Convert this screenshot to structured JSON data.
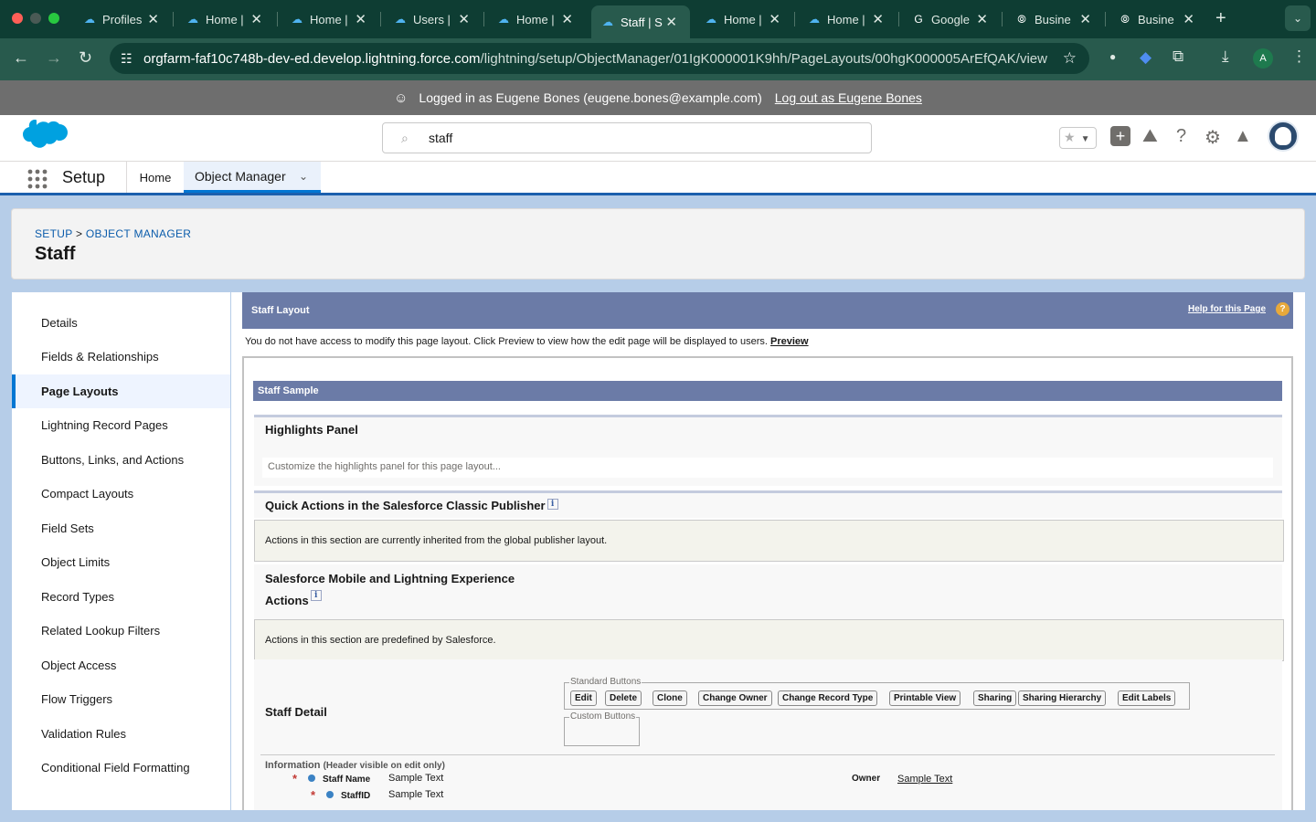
{
  "browser": {
    "tabs": [
      {
        "title": "Profiles",
        "icon": "salesforce-cloud-icon"
      },
      {
        "title": "Home |",
        "icon": "salesforce-cloud-icon"
      },
      {
        "title": "Home |",
        "icon": "salesforce-cloud-icon"
      },
      {
        "title": "Users |",
        "icon": "salesforce-cloud-icon"
      },
      {
        "title": "Home |",
        "icon": "salesforce-cloud-icon"
      },
      {
        "title": "Staff | S",
        "icon": "salesforce-cloud-icon",
        "active": true
      },
      {
        "title": "Home |",
        "icon": "salesforce-cloud-icon"
      },
      {
        "title": "Home |",
        "icon": "salesforce-cloud-icon"
      },
      {
        "title": "Google",
        "icon": "google-icon"
      },
      {
        "title": "Busine",
        "icon": "openai-icon"
      },
      {
        "title": "Busine",
        "icon": "openai-icon"
      }
    ],
    "url_host": "orgfarm-faf10c748b-dev-ed.develop.lightning.force.com",
    "url_path": "/lightning/setup/ObjectManager/01IgK000001K9hh/PageLayouts/00hgK000005ArEfQAK/view",
    "profile_initial": "A"
  },
  "login_banner": {
    "text": "Logged in as Eugene Bones (eugene.bones@example.com)",
    "logout_link": "Log out as Eugene Bones"
  },
  "header": {
    "search_value": "staff"
  },
  "subnav": {
    "app_name": "Setup",
    "home": "Home",
    "object_manager": "Object Manager"
  },
  "breadcrumb": {
    "setup": "SETUP",
    "separator": ">",
    "object_manager": "OBJECT MANAGER",
    "title": "Staff"
  },
  "left_nav": [
    {
      "label": "Details"
    },
    {
      "label": "Fields & Relationships"
    },
    {
      "label": "Page Layouts",
      "selected": true
    },
    {
      "label": "Lightning Record Pages"
    },
    {
      "label": "Buttons, Links, and Actions"
    },
    {
      "label": "Compact Layouts"
    },
    {
      "label": "Field Sets"
    },
    {
      "label": "Object Limits"
    },
    {
      "label": "Record Types"
    },
    {
      "label": "Related Lookup Filters"
    },
    {
      "label": "Object Access"
    },
    {
      "label": "Flow Triggers"
    },
    {
      "label": "Validation Rules"
    },
    {
      "label": "Conditional Field Formatting"
    }
  ],
  "layout": {
    "title": "Staff Layout",
    "help_link": "Help for this Page",
    "notice": "You do not have access to modify this page layout. Click Preview to view how the edit page will be displayed to users.",
    "preview_link": "Preview",
    "sample_header": "Staff Sample",
    "highlights_title": "Highlights Panel",
    "highlights_placeholder": "Customize the highlights panel for this page layout...",
    "classic_title": "Quick Actions in the Salesforce Classic Publisher",
    "classic_info": "Actions in this section are currently inherited from the global publisher layout.",
    "mobile_title_1": "Salesforce Mobile and Lightning Experience",
    "mobile_title_2": "Actions",
    "mobile_info": "Actions in this section are predefined by Salesforce.",
    "detail_title": "Staff Detail",
    "standard_buttons_legend": "Standard Buttons",
    "standard_buttons": [
      "Edit",
      "Delete",
      "Clone",
      "Change Owner",
      "Change Record Type",
      "Printable View",
      "Sharing",
      "Sharing Hierarchy",
      "Edit Labels"
    ],
    "custom_buttons_legend": "Custom Buttons",
    "info_section": "Information",
    "info_section_note": "(Header visible on edit only)",
    "fields": [
      {
        "label": "Staff Name",
        "value": "Sample Text",
        "required": "*"
      },
      {
        "label": "StaffID",
        "value": "Sample Text",
        "required": "*"
      }
    ],
    "owner_label": "Owner",
    "owner_value": "Sample Text"
  },
  "colors": {
    "browser_frame": "#0e3d33",
    "accent": "#0176d3",
    "section_bar": "#6b7ba7"
  }
}
